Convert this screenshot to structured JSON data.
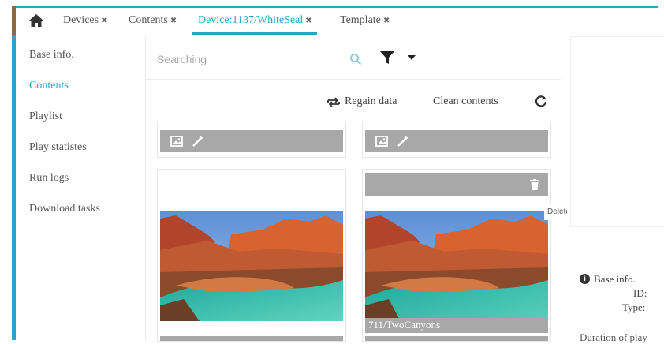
{
  "tabs": [
    {
      "label": "Devices",
      "close": "✖",
      "active": false
    },
    {
      "label": "Contents",
      "close": "✖",
      "active": false
    },
    {
      "label": "Device:1137/WhiteSeal",
      "close": "✖",
      "active": true
    },
    {
      "label": "Template",
      "close": "✖",
      "active": false
    }
  ],
  "sidebar": {
    "items": [
      {
        "label": "Base info.",
        "active": false
      },
      {
        "label": "Contents",
        "active": true
      },
      {
        "label": "Playlist",
        "active": false
      },
      {
        "label": "Play statistes",
        "active": false
      },
      {
        "label": "Run logs",
        "active": false
      },
      {
        "label": "Download tasks",
        "active": false
      }
    ]
  },
  "search": {
    "placeholder": "Searching",
    "value": ""
  },
  "actions": {
    "regain": "Regain data",
    "clean": "Clean contents"
  },
  "cards": [
    {
      "caption": ""
    },
    {
      "caption": "711/TwoCanyons"
    }
  ],
  "tooltip": {
    "text": "Delete"
  },
  "details": {
    "base_info": "Base info.",
    "id_label": "ID:",
    "type_label": "Type:",
    "duration": "Duration of play"
  },
  "colors": {
    "accent": "#2aa3c7",
    "toolbar_gray": "#a8a8a8"
  },
  "icons": [
    "home-icon",
    "search-icon",
    "filter-icon",
    "caret-down-icon",
    "regain-icon",
    "refresh-icon",
    "image-icon",
    "magic-wand-icon",
    "trash-icon",
    "info-icon"
  ]
}
